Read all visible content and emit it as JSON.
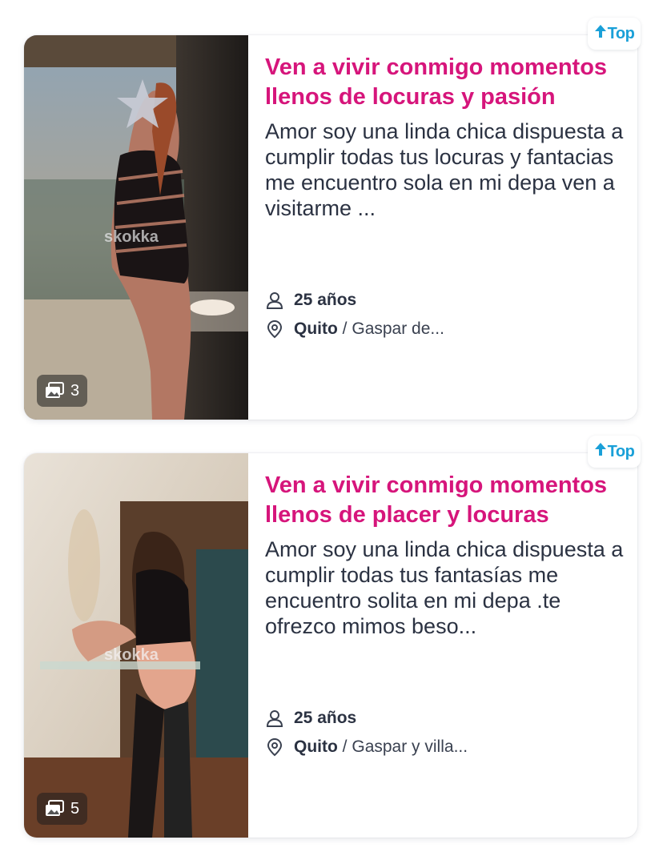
{
  "listings": [
    {
      "badge": "Top",
      "title": "Ven a vivir conmigo momentos llenos de locuras y pasión",
      "description": "Amor soy una linda chica dispuesta a cumplir todas tus locuras y fantacias me encuentro sola en mi depa ven a visitarme ...",
      "age": "25 años",
      "city": "Quito",
      "location_sep": "/",
      "area": "Gaspar de...",
      "photo_count": "3",
      "watermark": "skokka"
    },
    {
      "badge": "Top",
      "title": "Ven a vivir conmigo momentos llenos de placer y locuras",
      "description": "Amor soy una linda chica dispuesta a cumplir todas tus fantasías me encuentro solita en mi depa .te ofrezco mimos beso...",
      "age": "25 años",
      "city": "Quito",
      "location_sep": "/",
      "area": "Gaspar y villa...",
      "photo_count": "5",
      "watermark": "skokka"
    }
  ],
  "colors": {
    "title": "#d6157b",
    "badge": "#1aa0d8",
    "text": "#2b3242"
  },
  "icons": {
    "age": "person-icon",
    "location": "map-pin-icon",
    "photos": "image-gallery-icon",
    "badge": "arrow-up-icon"
  }
}
